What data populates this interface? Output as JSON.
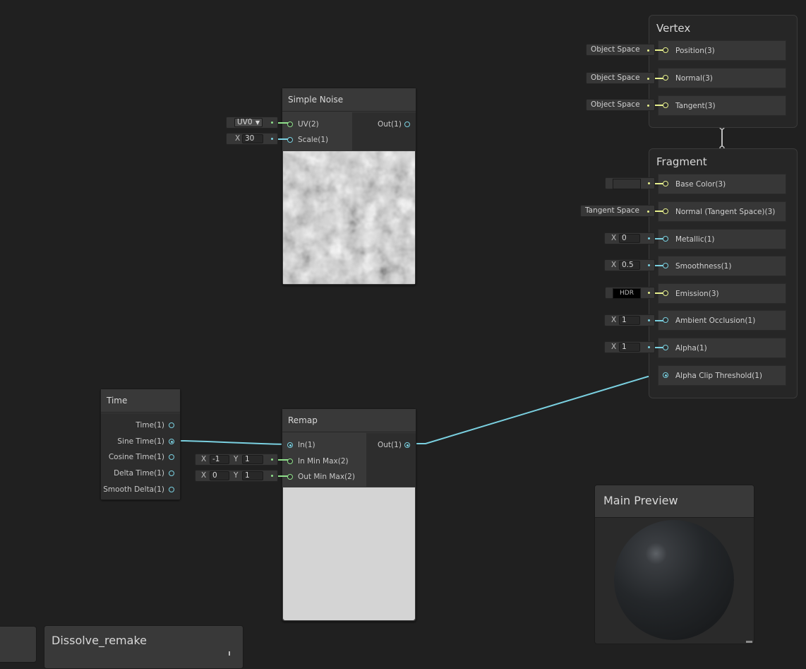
{
  "colors": {
    "canvas": "#202020",
    "node": "#393939",
    "float_port": "#7ad0e0",
    "vector3_port": "#e7f08d",
    "vector2_port": "#8fe08a"
  },
  "simple_noise": {
    "title": "Simple Noise",
    "uv_label": "UV(2)",
    "uv_dropdown": "UV0",
    "scale_label": "Scale(1)",
    "scale_axis": "X",
    "scale_value": "30",
    "out_label": "Out(1)"
  },
  "time_node": {
    "title": "Time",
    "outputs": [
      "Time(1)",
      "Sine Time(1)",
      "Cosine Time(1)",
      "Delta Time(1)",
      "Smooth Delta(1)"
    ]
  },
  "remap": {
    "title": "Remap",
    "in_label": "In(1)",
    "in_min_max_label": "In Min Max(2)",
    "in_min_x": "-1",
    "in_min_y": "1",
    "out_min_max_label": "Out Min Max(2)",
    "out_min_x": "0",
    "out_min_y": "1",
    "out_label": "Out(1)",
    "axis_x": "X",
    "axis_y": "Y"
  },
  "vertex": {
    "title": "Vertex",
    "slots": [
      {
        "label": "Position(3)",
        "space": "Object Space"
      },
      {
        "label": "Normal(3)",
        "space": "Object Space"
      },
      {
        "label": "Tangent(3)",
        "space": "Object Space"
      }
    ]
  },
  "fragment": {
    "title": "Fragment",
    "base_color": "Base Color(3)",
    "normal": "Normal (Tangent Space)(3)",
    "normal_space": "Tangent Space",
    "metallic": "Metallic(1)",
    "metallic_value": "0",
    "smoothness": "Smoothness(1)",
    "smoothness_value": "0.5",
    "emission": "Emission(3)",
    "emission_tag": "HDR",
    "ao": "Ambient Occlusion(1)",
    "ao_value": "1",
    "alpha": "Alpha(1)",
    "alpha_value": "1",
    "alpha_clip": "Alpha Clip Threshold(1)",
    "axis_x": "X"
  },
  "main_preview": {
    "title": "Main Preview"
  },
  "blackboard": {
    "title": "Dissolve_remake"
  }
}
